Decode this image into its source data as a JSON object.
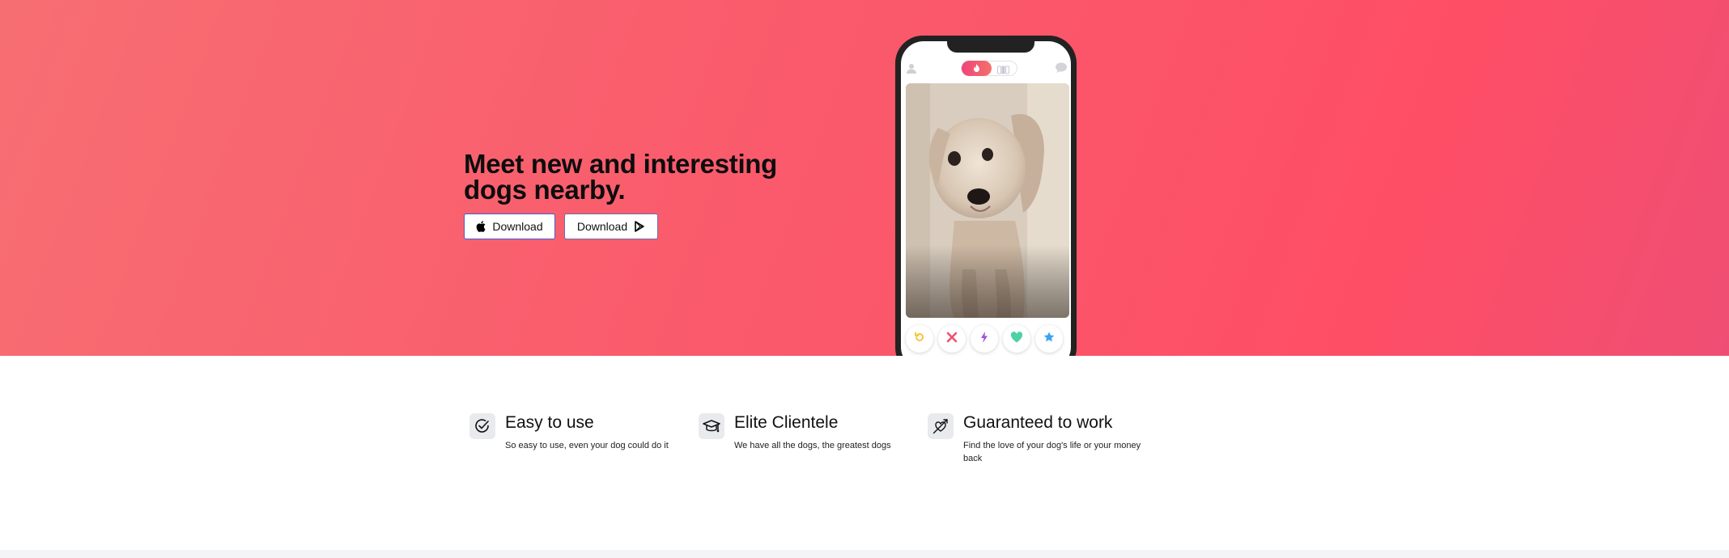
{
  "hero": {
    "headline": "Meet new and interesting dogs nearby.",
    "buttons": [
      {
        "label": "Download",
        "icon": "apple-icon"
      },
      {
        "label": "Download",
        "icon": "google-play-icon"
      }
    ],
    "colors": {
      "gradient_start": "#f76e72",
      "gradient_end": "#fe4e66"
    }
  },
  "phone": {
    "top_icons": [
      "profile-icon",
      "flame-icon",
      "explore-icon",
      "chat-icon"
    ],
    "actions": [
      {
        "name": "rewind",
        "icon": "rewind-icon",
        "color": "#f5c542"
      },
      {
        "name": "nope",
        "icon": "close-icon",
        "color": "#f0506e"
      },
      {
        "name": "boost",
        "icon": "bolt-icon",
        "color": "#9a55d6"
      },
      {
        "name": "like",
        "icon": "heart-icon",
        "color": "#4fd1a4"
      },
      {
        "name": "super-like",
        "icon": "star-icon",
        "color": "#3aa3f0"
      }
    ]
  },
  "features": [
    {
      "title": "Easy to use",
      "description": "So easy to use, even your dog could do it",
      "icon": "check-circle-icon"
    },
    {
      "title": "Elite Clientele",
      "description": "We have all the dogs, the greatest dogs",
      "icon": "graduation-cap-icon"
    },
    {
      "title": "Guaranteed to work",
      "description": "Find the love of your dog's life or your money back",
      "icon": "heart-arrow-icon"
    }
  ]
}
